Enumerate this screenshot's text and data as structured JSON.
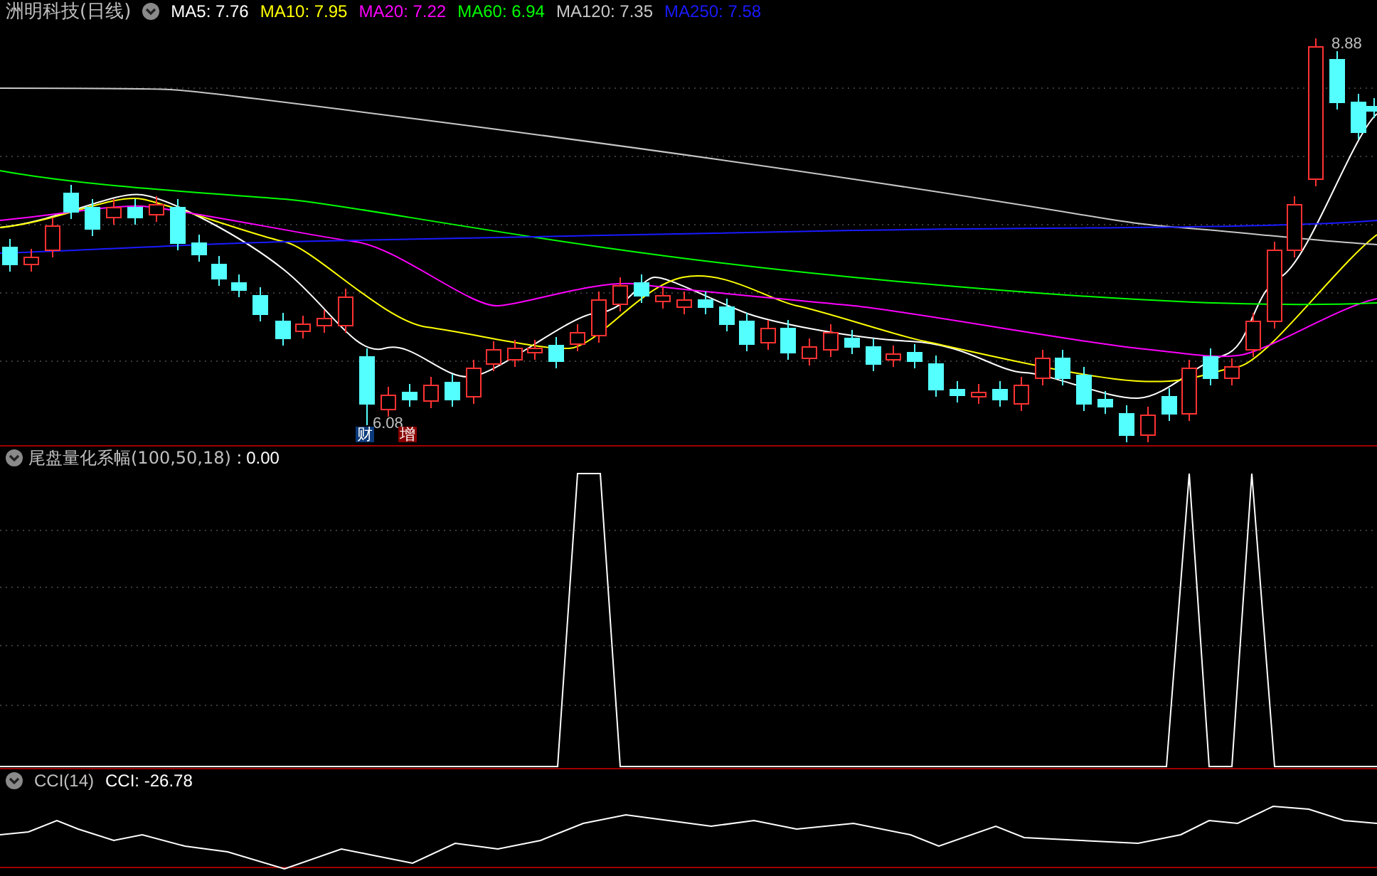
{
  "price_panel": {
    "title": "洲明科技(日线)",
    "legend": [
      {
        "label": "MA5: 7.76",
        "color": "#ffffff"
      },
      {
        "label": "MA10: 7.95",
        "color": "#ffff00"
      },
      {
        "label": "MA20: 7.22",
        "color": "#ff00ff"
      },
      {
        "label": "MA60: 6.94",
        "color": "#00ff00"
      },
      {
        "label": "MA120: 7.35",
        "color": "#c8c8c8"
      },
      {
        "label": "MA250: 7.58",
        "color": "#1a1aff"
      }
    ],
    "high_label": "8.88",
    "low_label": "6.08",
    "markers": [
      {
        "label": "财",
        "color": "#0a3a7a"
      },
      {
        "label": "增",
        "color": "#8a0000"
      }
    ]
  },
  "indicator_panel": {
    "title": "尾盘量化系幅(100,50,18)",
    "value": ": 0.00"
  },
  "cci_panel": {
    "title": "CCI(14)",
    "value": "CCI: -26.78"
  }
}
